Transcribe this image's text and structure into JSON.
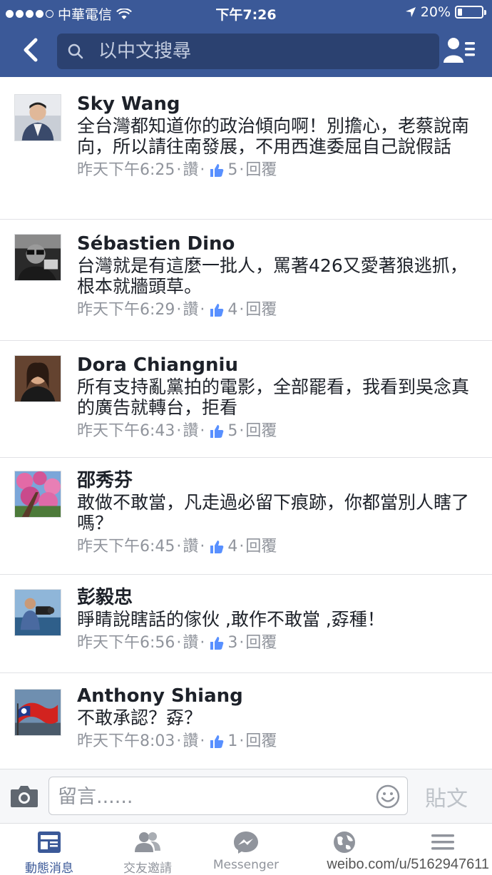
{
  "status_bar": {
    "carrier": "中華電信",
    "time": "下午7:26",
    "battery": "20%",
    "battery_level": 0.2
  },
  "nav": {
    "search_placeholder": "以中文搜尋"
  },
  "comments": [
    {
      "name": "Sky Wang",
      "text": "全台灣都知道你的政治傾向啊！別擔心，老蔡說南向，所以請往南發展，不用西進委屈自己說假話",
      "time": "昨天下午6:25",
      "like_label": "讚",
      "likes": "5",
      "reply_label": "回覆"
    },
    {
      "name": "Sébastien Dino",
      "text": "台灣就是有這麼一批人，罵著426又愛著狼逃抓，根本就牆頭草。",
      "time": "昨天下午6:29",
      "like_label": "讚",
      "likes": "4",
      "reply_label": "回覆"
    },
    {
      "name": "Dora Chiangniu",
      "text": "所有支持亂黨拍的電影，全部罷看，我看到吳念真的廣告就轉台，拒看",
      "time": "昨天下午6:43",
      "like_label": "讚",
      "likes": "5",
      "reply_label": "回覆"
    },
    {
      "name": "邵秀芬",
      "text": "敢做不敢當，凡走過必留下痕跡，你都當別人瞎了嗎？",
      "time": "昨天下午6:45",
      "like_label": "讚",
      "likes": "4",
      "reply_label": "回覆"
    },
    {
      "name": "彭毅忠",
      "text": "睜睛說瞎話的傢伙 ,敢作不敢當 ,孬種！",
      "time": "昨天下午6:56",
      "like_label": "讚",
      "likes": "3",
      "reply_label": "回覆"
    },
    {
      "name": "Anthony Shiang",
      "text": "不敢承認？孬？",
      "time": "昨天下午8:03",
      "like_label": "讚",
      "likes": "1",
      "reply_label": "回覆"
    }
  ],
  "composer": {
    "placeholder": "留言......",
    "post_label": "貼文"
  },
  "tabs": [
    {
      "label": "動態消息",
      "icon": "news-feed-icon",
      "active": true
    },
    {
      "label": "交友邀請",
      "icon": "friend-requests-icon",
      "active": false
    },
    {
      "label": "Messenger",
      "icon": "messenger-icon",
      "active": false
    },
    {
      "label": "",
      "icon": "globe-icon",
      "active": false
    },
    {
      "label": "",
      "icon": "menu-icon",
      "active": false
    }
  ],
  "watermark": "weibo.com/u/5162947611",
  "colors": {
    "facebook_blue": "#3b5998",
    "meta_gray": "#90949c"
  }
}
